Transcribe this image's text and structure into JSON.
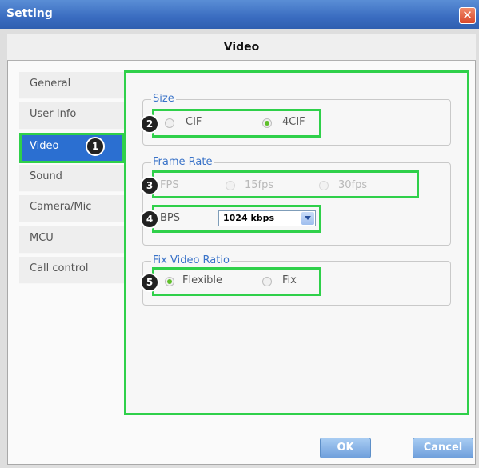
{
  "window": {
    "title": "Setting",
    "close_glyph": "✕"
  },
  "page": {
    "section_title": "Video"
  },
  "sidebar": {
    "items": [
      {
        "label": "General"
      },
      {
        "label": "User Info"
      },
      {
        "label": "Video"
      },
      {
        "label": "Sound"
      },
      {
        "label": "Camera/Mic"
      },
      {
        "label": "MCU"
      },
      {
        "label": "Call control"
      }
    ],
    "active_index": 2
  },
  "badges": {
    "b1": "1",
    "b2": "2",
    "b3": "3",
    "b4": "4",
    "b5": "5"
  },
  "size_group": {
    "label": "Size",
    "options": [
      {
        "label": "CIF",
        "selected": false
      },
      {
        "label": "4CIF",
        "selected": true
      }
    ]
  },
  "frame_rate_group": {
    "label": "Frame Rate",
    "fps_label": "FPS",
    "fps_options": [
      {
        "label": "15fps",
        "selected": false
      },
      {
        "label": "30fps",
        "selected": false
      }
    ],
    "bps_label": "BPS",
    "bps_value": "1024 kbps"
  },
  "ratio_group": {
    "label": "Fix Video Ratio",
    "options": [
      {
        "label": "Flexible",
        "selected": true
      },
      {
        "label": "Fix",
        "selected": false
      }
    ]
  },
  "footer": {
    "ok_label": "OK",
    "cancel_label": "Cancel"
  },
  "colors": {
    "accent_blue": "#2b6fd1",
    "highlight_green": "#2fd04a",
    "radio_green": "#5fbf2a"
  }
}
